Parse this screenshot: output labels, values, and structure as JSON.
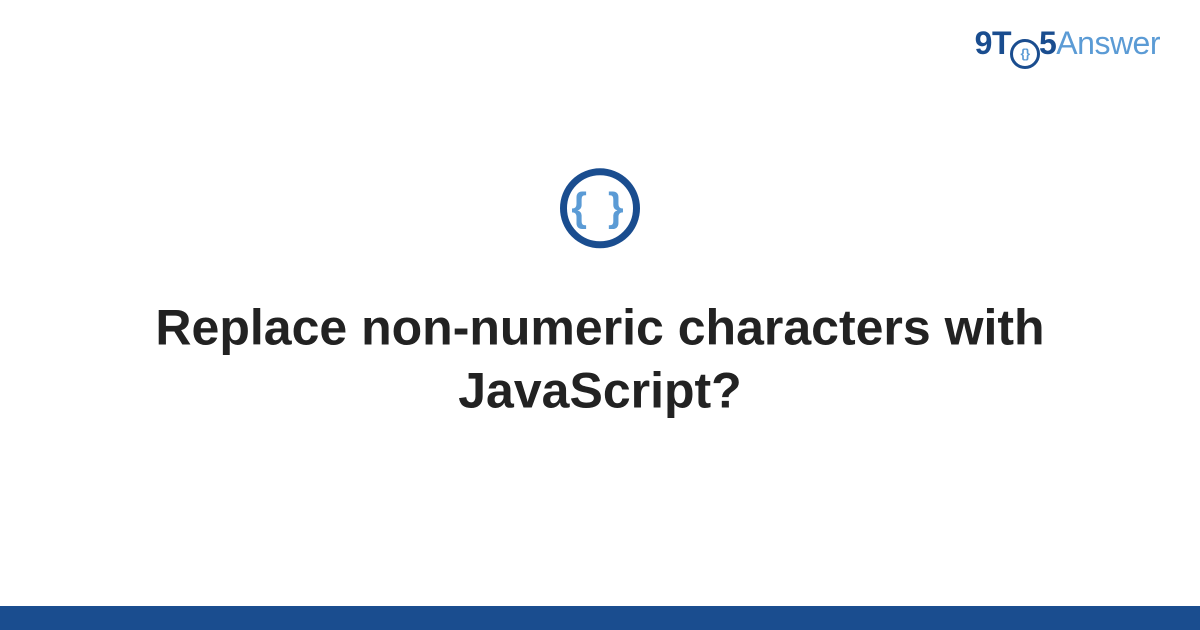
{
  "logo": {
    "part1": "9T",
    "circle_text": "{}",
    "part2": "5",
    "part3": "Answer"
  },
  "icon": {
    "name": "braces-icon",
    "glyph": "{ }"
  },
  "title": "Replace non-numeric characters with JavaScript?",
  "colors": {
    "primary": "#1a4d8f",
    "accent": "#5b9bd5",
    "text": "#222222"
  }
}
